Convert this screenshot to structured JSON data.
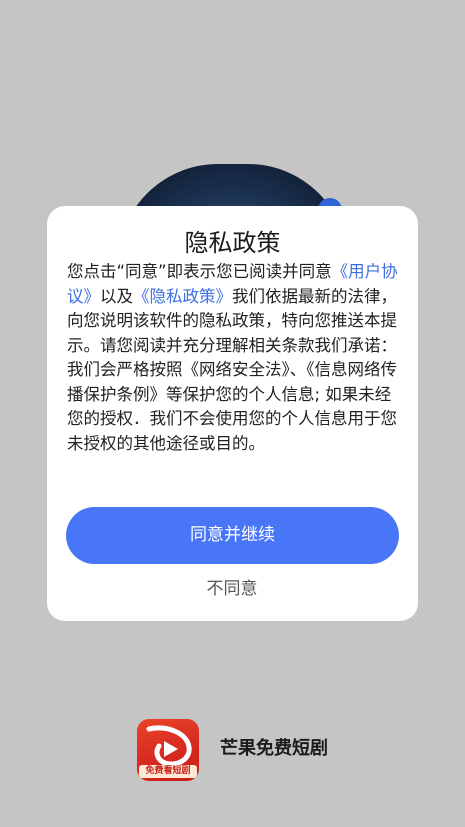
{
  "dialog": {
    "title": "隐私政策",
    "body": {
      "intro": "您点击“同意”即表示您已阅读并同意",
      "user_agreement_link": "《用户协议》",
      "conjunction": "以及",
      "privacy_policy_link": "《隐私政策》",
      "statement": "我们依据最新的法律，向您说明该软件的隐私政策，特向您推送本提示。请您阅读并充分理解相关条款我们承诺：",
      "commitment": "我们会严格按照《网络安全法》、《信息网络传播保护条例》等保护您的个人信息; 如果未经您的授权．我们不会使用您的个人信息用于您未授权的其他途径或目的。"
    },
    "agree_button": "同意并继续",
    "disagree_button": "不同意"
  },
  "app": {
    "logo_caption": "免费看短剧",
    "name": "芒果免费短剧"
  },
  "colors": {
    "background": "#c5c5c5",
    "accent": "#4876f7",
    "link": "#3c6fe0",
    "logo_red": "#d6281f"
  }
}
